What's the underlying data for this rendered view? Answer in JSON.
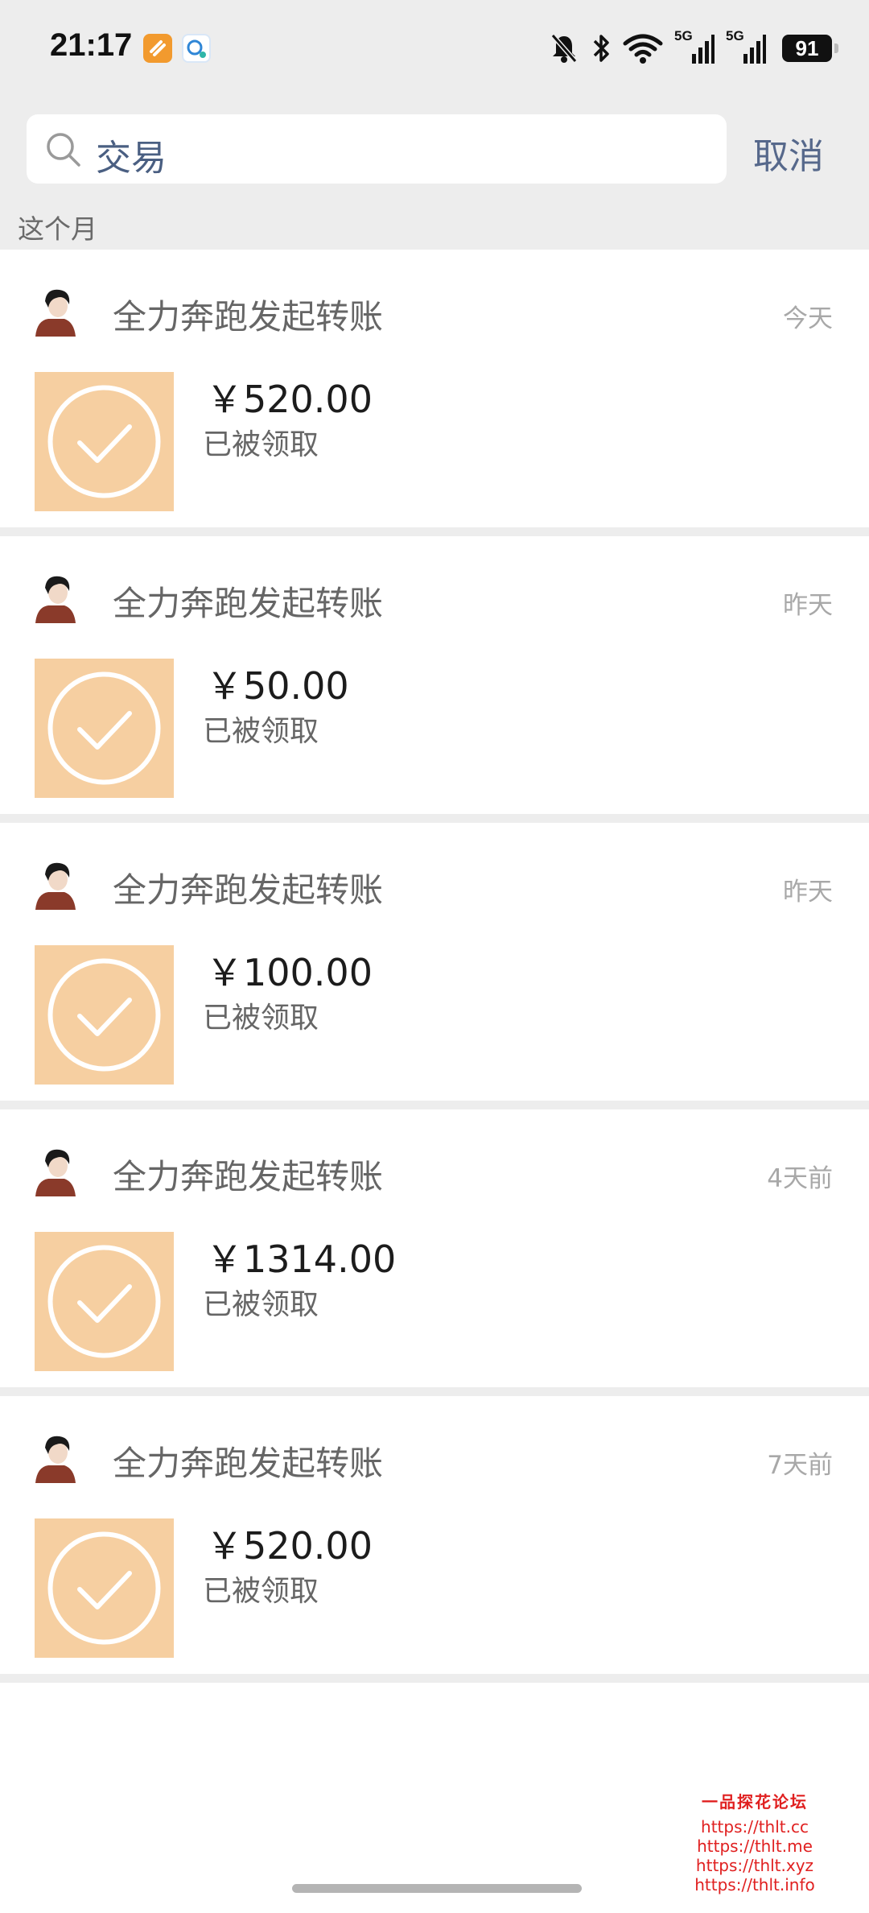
{
  "status_bar": {
    "time": "21:17",
    "battery": "91",
    "network_labels": [
      "5G",
      "5G"
    ],
    "icons": [
      "app-orange-icon",
      "app-chat-icon",
      "bell-muted-icon",
      "bluetooth-icon",
      "wifi-icon",
      "signal-icon",
      "signal-icon",
      "battery-icon"
    ]
  },
  "search": {
    "value": "交易",
    "cancel_label": "取消"
  },
  "section_label": "这个月",
  "transfers": [
    {
      "sender": "全力奔跑发起转账",
      "date": "今天",
      "amount": "￥520.00",
      "status": "已被领取"
    },
    {
      "sender": "全力奔跑发起转账",
      "date": "昨天",
      "amount": "￥50.00",
      "status": "已被领取"
    },
    {
      "sender": "全力奔跑发起转账",
      "date": "昨天",
      "amount": "￥100.00",
      "status": "已被领取"
    },
    {
      "sender": "全力奔跑发起转账",
      "date": "4天前",
      "amount": "￥1314.00",
      "status": "已被领取"
    },
    {
      "sender": "全力奔跑发起转账",
      "date": "7天前",
      "amount": "￥520.00",
      "status": "已被领取"
    }
  ],
  "watermark": {
    "title": "一品探花论坛",
    "links": [
      "https://thlt.cc",
      "https://thlt.me",
      "https://thlt.xyz",
      "https://thlt.info"
    ]
  },
  "colors": {
    "background": "#ededed",
    "tile": "#f6cfa1",
    "link": "#56688b",
    "watermark": "#e02020"
  }
}
